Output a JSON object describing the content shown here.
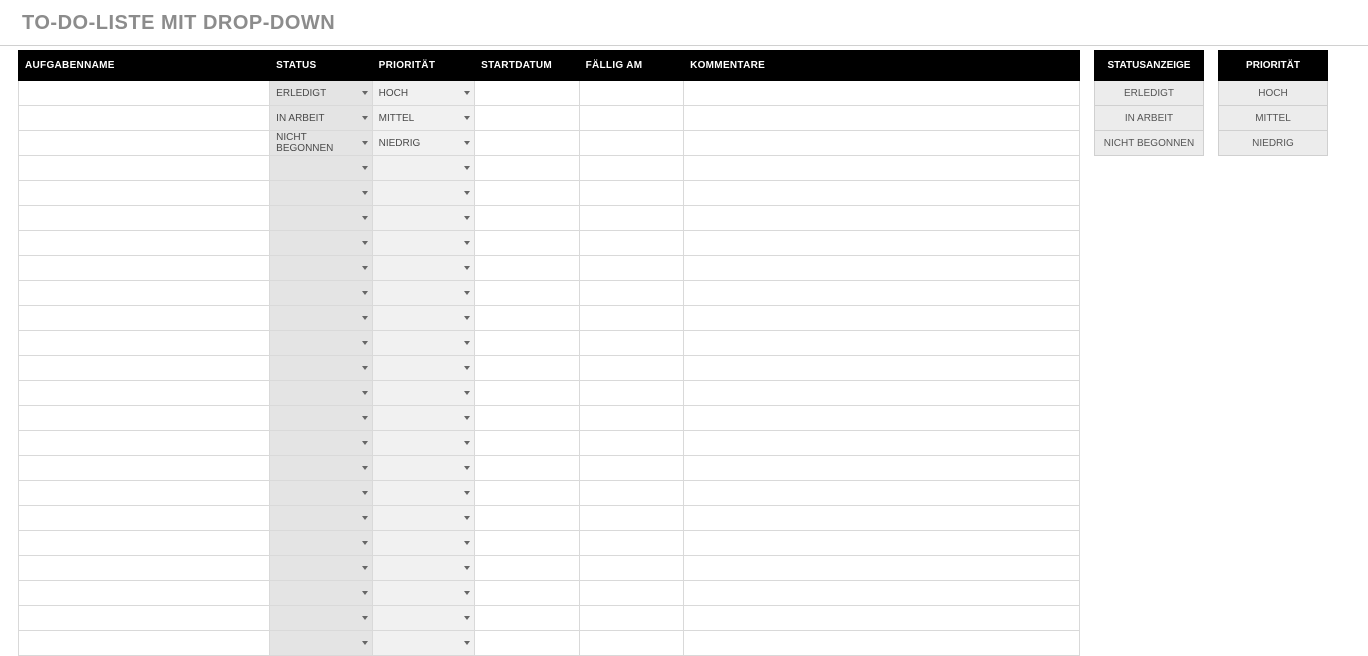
{
  "title": "TO-DO-LISTE MIT DROP-DOWN",
  "columns": {
    "name": "AUFGABENNAME",
    "status": "STATUS",
    "priority": "PRIORITÄT",
    "startdate": "STARTDATUM",
    "duedate": "FÄLLIG AM",
    "comments": "KOMMENTARE"
  },
  "rows": [
    {
      "name": "",
      "status": "ERLEDIGT",
      "priority": "HOCH",
      "startdate": "",
      "duedate": "",
      "comments": ""
    },
    {
      "name": "",
      "status": "IN ARBEIT",
      "priority": "MITTEL",
      "startdate": "",
      "duedate": "",
      "comments": ""
    },
    {
      "name": "",
      "status": "NICHT BEGONNEN",
      "priority": "NIEDRIG",
      "startdate": "",
      "duedate": "",
      "comments": ""
    },
    {
      "name": "",
      "status": "",
      "priority": "",
      "startdate": "",
      "duedate": "",
      "comments": ""
    },
    {
      "name": "",
      "status": "",
      "priority": "",
      "startdate": "",
      "duedate": "",
      "comments": ""
    },
    {
      "name": "",
      "status": "",
      "priority": "",
      "startdate": "",
      "duedate": "",
      "comments": ""
    },
    {
      "name": "",
      "status": "",
      "priority": "",
      "startdate": "",
      "duedate": "",
      "comments": ""
    },
    {
      "name": "",
      "status": "",
      "priority": "",
      "startdate": "",
      "duedate": "",
      "comments": ""
    },
    {
      "name": "",
      "status": "",
      "priority": "",
      "startdate": "",
      "duedate": "",
      "comments": ""
    },
    {
      "name": "",
      "status": "",
      "priority": "",
      "startdate": "",
      "duedate": "",
      "comments": ""
    },
    {
      "name": "",
      "status": "",
      "priority": "",
      "startdate": "",
      "duedate": "",
      "comments": ""
    },
    {
      "name": "",
      "status": "",
      "priority": "",
      "startdate": "",
      "duedate": "",
      "comments": ""
    },
    {
      "name": "",
      "status": "",
      "priority": "",
      "startdate": "",
      "duedate": "",
      "comments": ""
    },
    {
      "name": "",
      "status": "",
      "priority": "",
      "startdate": "",
      "duedate": "",
      "comments": ""
    },
    {
      "name": "",
      "status": "",
      "priority": "",
      "startdate": "",
      "duedate": "",
      "comments": ""
    },
    {
      "name": "",
      "status": "",
      "priority": "",
      "startdate": "",
      "duedate": "",
      "comments": ""
    },
    {
      "name": "",
      "status": "",
      "priority": "",
      "startdate": "",
      "duedate": "",
      "comments": ""
    },
    {
      "name": "",
      "status": "",
      "priority": "",
      "startdate": "",
      "duedate": "",
      "comments": ""
    },
    {
      "name": "",
      "status": "",
      "priority": "",
      "startdate": "",
      "duedate": "",
      "comments": ""
    },
    {
      "name": "",
      "status": "",
      "priority": "",
      "startdate": "",
      "duedate": "",
      "comments": ""
    },
    {
      "name": "",
      "status": "",
      "priority": "",
      "startdate": "",
      "duedate": "",
      "comments": ""
    },
    {
      "name": "",
      "status": "",
      "priority": "",
      "startdate": "",
      "duedate": "",
      "comments": ""
    },
    {
      "name": "",
      "status": "",
      "priority": "",
      "startdate": "",
      "duedate": "",
      "comments": ""
    }
  ],
  "legend_status": {
    "header": "STATUSANZEIGE",
    "items": [
      "ERLEDIGT",
      "IN ARBEIT",
      "NICHT BEGONNEN"
    ]
  },
  "legend_priority": {
    "header": "PRIORITÄT",
    "items": [
      "HOCH",
      "MITTEL",
      "NIEDRIG"
    ]
  }
}
